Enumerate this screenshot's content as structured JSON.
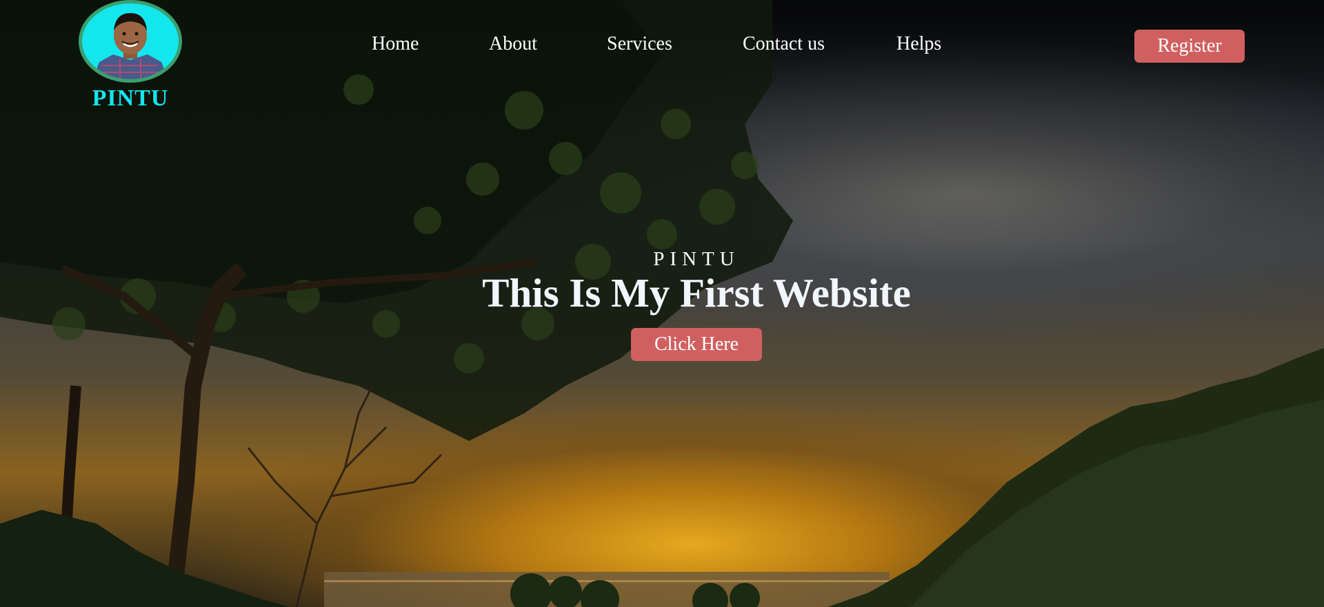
{
  "brand": {
    "name": "PINTU",
    "avatar_icon": "profile-photo-avatar",
    "color": "#14e6ee"
  },
  "nav": {
    "items": [
      {
        "label": "Home"
      },
      {
        "label": "About"
      },
      {
        "label": "Services"
      },
      {
        "label": "Contact us"
      },
      {
        "label": "Helps"
      }
    ]
  },
  "register": {
    "label": "Register",
    "color": "#d06060"
  },
  "hero": {
    "kicker": "PINTU",
    "headline": "This Is My First Website",
    "cta_label": "Click Here",
    "background": "sunset-landscape-with-tree-and-hills"
  }
}
